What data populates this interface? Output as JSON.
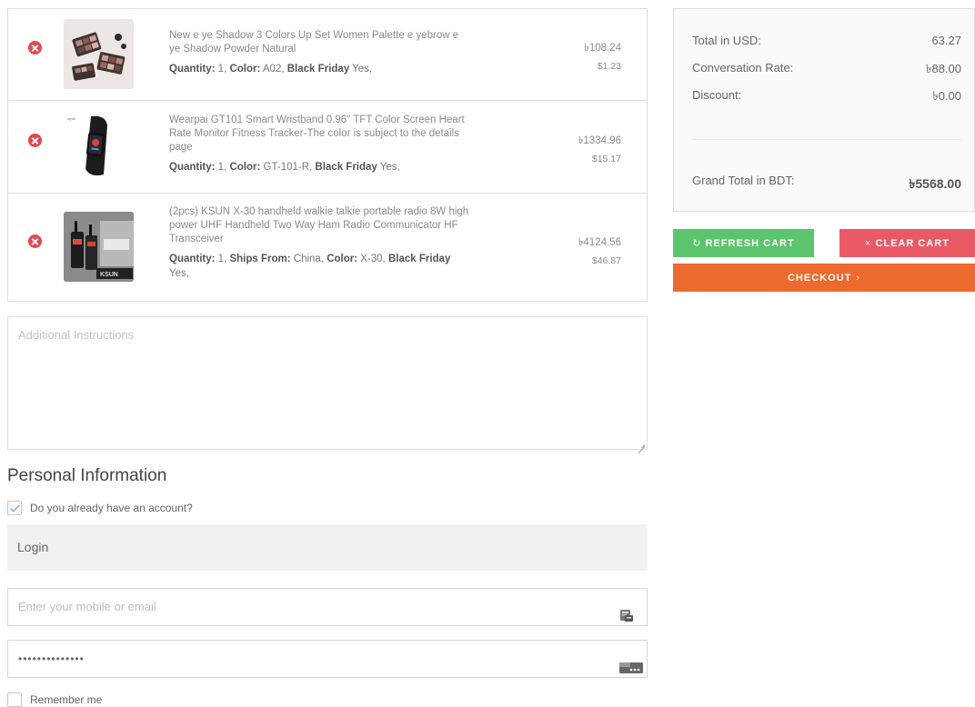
{
  "cart": {
    "items": [
      {
        "title": "New e ye Shadow 3 Colors Up Set Women Palette e yebrow e ye Shadow Powder Natural",
        "price_bdt": "৳108.24",
        "price_usd": "$1.23",
        "meta": [
          {
            "label": "Quantity:",
            "value": " 1, "
          },
          {
            "label": "Color:",
            "value": " A02, "
          },
          {
            "label": "Black Friday",
            "value": " Yes,"
          }
        ]
      },
      {
        "title": "Wearpai GT101 Smart Wristband 0.96\" TFT Color Screen Heart Rate Monitor Fitness Tracker-The color is subject to the details page",
        "price_bdt": "৳1334.96",
        "price_usd": "$15.17",
        "meta": [
          {
            "label": "Quantity:",
            "value": " 1, "
          },
          {
            "label": "Color:",
            "value": " GT-101-R, "
          },
          {
            "label": "Black Friday",
            "value": " Yes,"
          }
        ]
      },
      {
        "title": "(2pcs) KSUN X-30 handheld walkie talkie portable radio 8W high power UHF Handheld Two Way Ham Radio Communicator HF Transceiver",
        "price_bdt": "৳4124.56",
        "price_usd": "$46.87",
        "meta": [
          {
            "label": "Quantity:",
            "value": " 1, "
          },
          {
            "label": "Ships From:",
            "value": " China, "
          },
          {
            "label": "Color:",
            "value": " X-30, "
          },
          {
            "label": "Black Friday",
            "value": " Yes,"
          }
        ]
      }
    ]
  },
  "instructions": {
    "placeholder": "Additional Instructions"
  },
  "personal": {
    "title": "Personal Information",
    "has_account_label": "Do you already have an account?",
    "has_account_checked": true,
    "login_label": "Login",
    "email_placeholder": "Enter your mobile or email",
    "password_value": "••••••••••••••",
    "remember_label": "Remember me"
  },
  "summary": {
    "total_usd_label": "Total in USD:",
    "total_usd_value": "63.27",
    "rate_label": "Conversation Rate:",
    "rate_value": "৳88.00",
    "discount_label": "Discount:",
    "discount_value": "৳0.00",
    "grand_label": "Grand Total in BDT:",
    "grand_value": "৳5568.00"
  },
  "buttons": {
    "refresh": "REFRESH CART",
    "refresh_icon": "↻",
    "clear": "CLEAR CART",
    "clear_icon": "×",
    "checkout": "CHECKOUT",
    "checkout_icon": "›"
  },
  "colors": {
    "remove": "#e5474b",
    "refresh": "#5cc46c",
    "clear": "#ea5a65",
    "checkout": "#ec6a2d"
  }
}
